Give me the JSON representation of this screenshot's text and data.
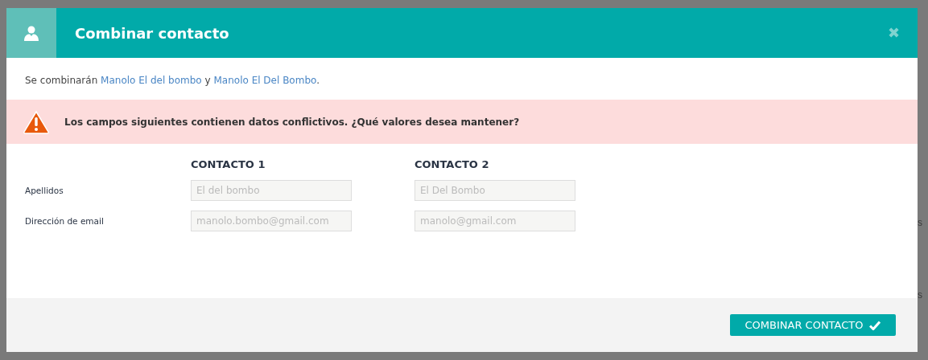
{
  "background": {
    "texts": [
      "s",
      "s"
    ]
  },
  "dialog": {
    "title": "Combinar contacto",
    "close": "✖",
    "intro": {
      "prefix": "Se combinarán",
      "first": "Manolo El del bombo",
      "joiner": "y",
      "second": "Manolo El Del Bombo",
      "suffix": "."
    },
    "alert": "Los campos siguientes contienen datos conflictivos. ¿Qué valores desea mantener?",
    "columns": [
      "CONTACTO 1",
      "CONTACTO 2"
    ],
    "rows": [
      {
        "label": "Apellidos",
        "values": [
          "El del bombo",
          "El Del Bombo"
        ]
      },
      {
        "label": "Dirección de email",
        "values": [
          "manolo.bombo@gmail.com",
          "manolo@gmail.com"
        ]
      }
    ],
    "button": "COMBINAR CONTACTO"
  }
}
